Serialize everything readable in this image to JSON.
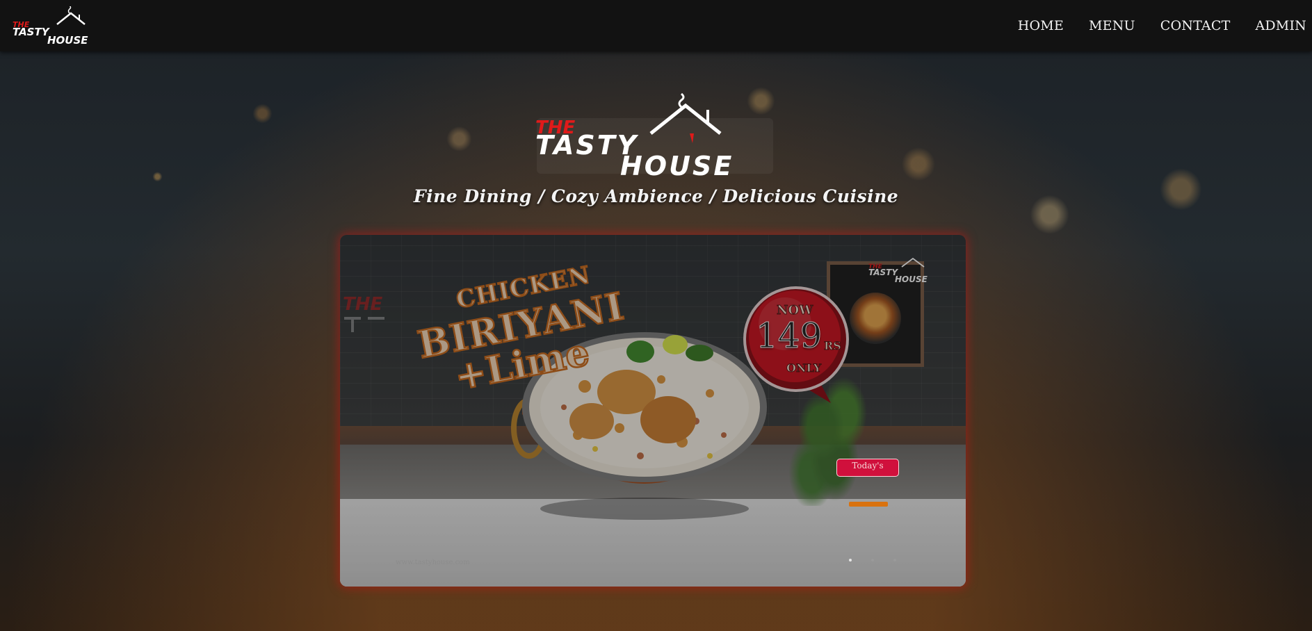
{
  "nav": {
    "brand": {
      "the": "THE",
      "tasty": "TASTY",
      "house": "HOUSE"
    },
    "links": [
      {
        "label": "HOME"
      },
      {
        "label": "MENU"
      },
      {
        "label": "CONTACT"
      },
      {
        "label": "ADMIN"
      }
    ]
  },
  "hero": {
    "logo": {
      "the": "THE",
      "tasty": "TASTY",
      "house": "HOUSE"
    },
    "tagline": "Fine Dining / Cozy Ambience / Delicious Cuisine"
  },
  "slide": {
    "wall_logo_the": "THE",
    "brand": {
      "the": "THE",
      "tasty": "TASTY",
      "house": "HOUSE"
    },
    "dish_line1": "CHICKEN",
    "dish_line2": "BIRIYANI",
    "dish_line3": "+Lime",
    "price": {
      "now": "NOW",
      "amount": "149",
      "currency": "RS",
      "only": "ONLY"
    },
    "todays_label": "Today's",
    "website": "www.tastyhouse.com",
    "dots_count": 3
  },
  "colors": {
    "nav_bg": "#121212",
    "accent_red": "#e01a1a",
    "price_red": "#c8101c",
    "title_orange": "#c8671a",
    "button_crimson": "#d0103c"
  }
}
